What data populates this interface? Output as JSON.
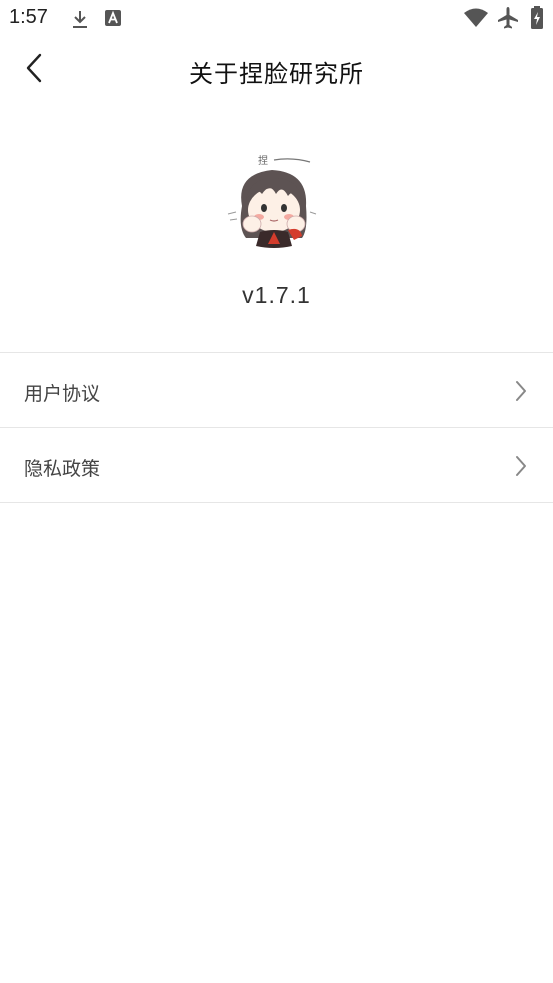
{
  "status_bar": {
    "time": "1:57",
    "left_icons": [
      "download-icon",
      "text-a-icon"
    ],
    "right_icons": [
      "wifi-icon",
      "airplane-icon",
      "battery-charging-icon"
    ]
  },
  "header": {
    "title": "关于捏脸研究所",
    "back_icon": "chevron-left-icon"
  },
  "about": {
    "logo_icon": "anime-girl-logo",
    "logo_caption": "捏",
    "version": "v1.7.1"
  },
  "menu": {
    "items": [
      {
        "label": "用户协议",
        "icon": "chevron-right-icon"
      },
      {
        "label": "隐私政策",
        "icon": "chevron-right-icon"
      }
    ]
  },
  "colors": {
    "background": "#ffffff",
    "divider": "#e6e6e6",
    "text_primary": "#111111",
    "text_secondary": "#444444",
    "chevron": "#888888"
  }
}
